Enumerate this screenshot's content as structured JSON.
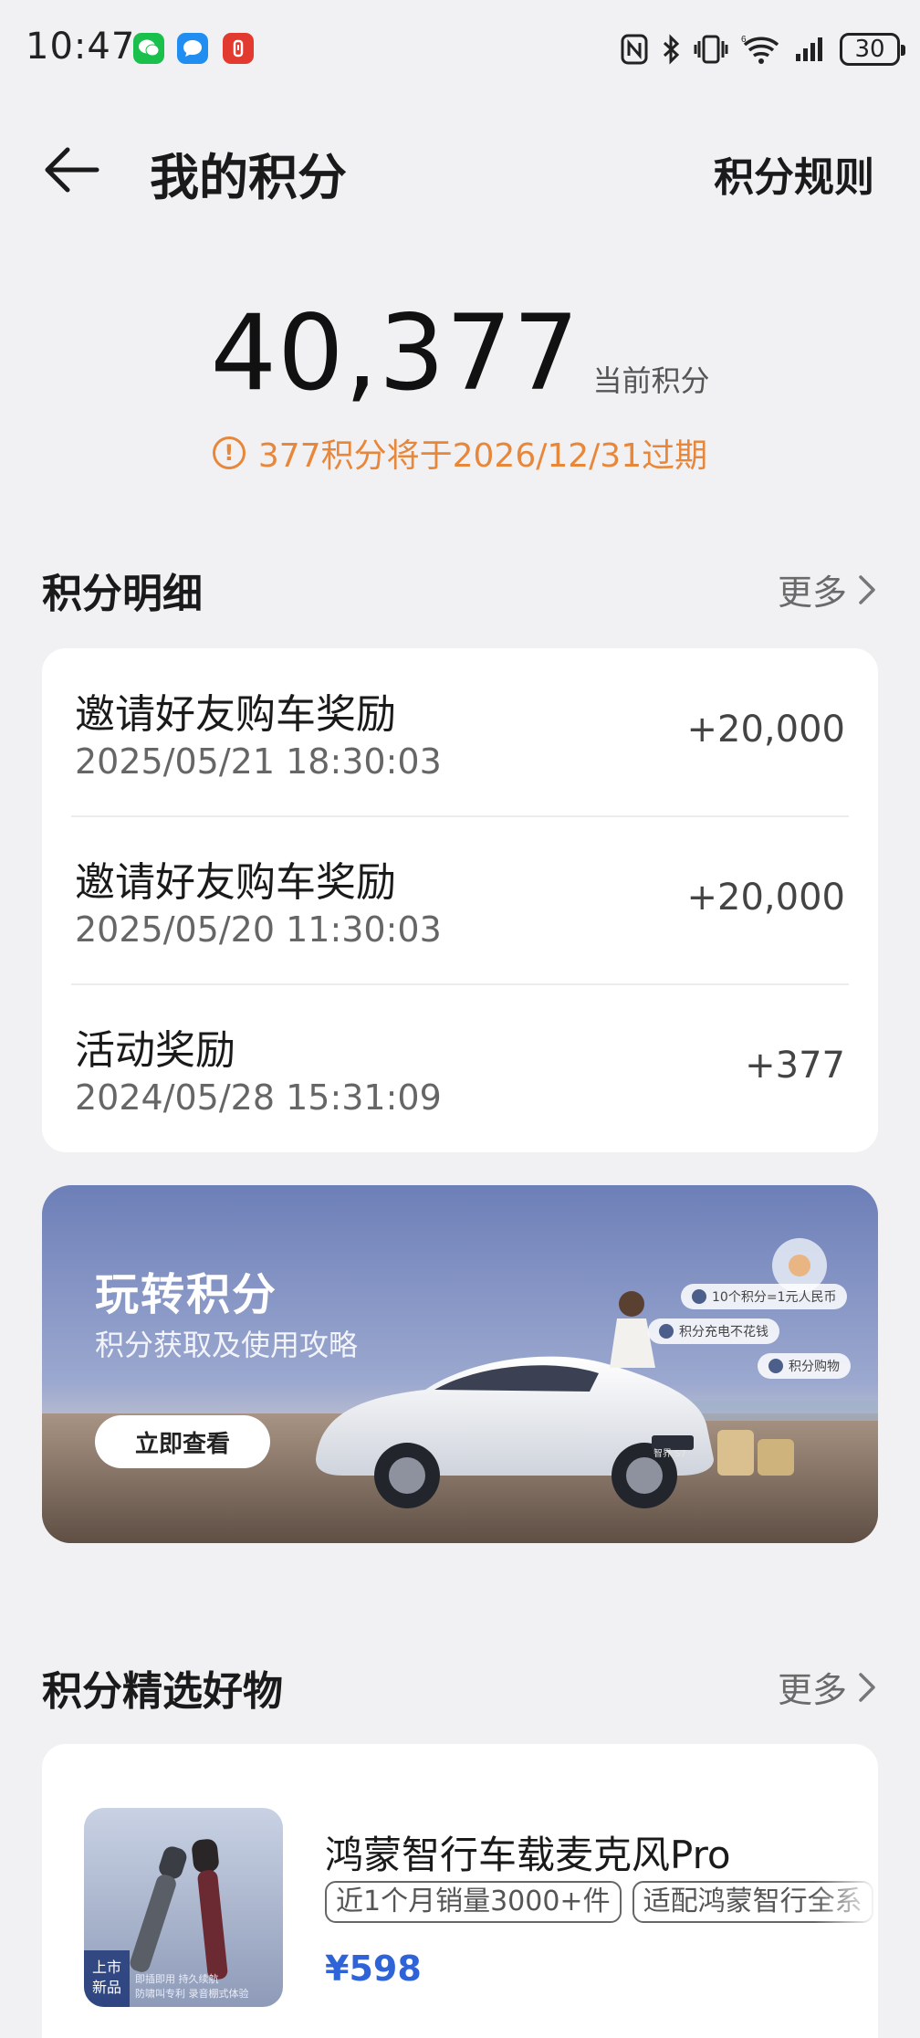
{
  "status_bar": {
    "time": "10:47",
    "battery": "30",
    "apps": [
      "wechat-icon",
      "messages-icon",
      "red-app-icon"
    ]
  },
  "header": {
    "title": "我的积分",
    "rules_label": "积分规则"
  },
  "points": {
    "value": "40,377",
    "label": "当前积分",
    "expiry_notice": "377积分将于2026/12/31过期"
  },
  "details": {
    "title": "积分明细",
    "more_label": "更多",
    "records": [
      {
        "title": "邀请好友购车奖励",
        "time": "2025/05/21 18:30:03",
        "amount": "+20,000"
      },
      {
        "title": "邀请好友购车奖励",
        "time": "2025/05/20 11:30:03",
        "amount": "+20,000"
      },
      {
        "title": "活动奖励",
        "time": "2024/05/28 15:31:09",
        "amount": "+377"
      }
    ]
  },
  "banner": {
    "title": "玩转积分",
    "subtitle": "积分获取及使用攻略",
    "button_label": "立即查看",
    "tags": [
      "10个积分=1元人民币",
      "积分充电不花钱",
      "积分购物"
    ],
    "plate": "智界 S7"
  },
  "products": {
    "title": "积分精选好物",
    "more_label": "更多",
    "items": [
      {
        "name": "鸿蒙智行车载麦克风Pro",
        "chips": [
          "近1个月销量3000+件",
          "适配鸿蒙智行全系"
        ],
        "price": "¥598",
        "badge_line1": "上市",
        "badge_line2": "新品",
        "caption_line1": "即插即用   持久续航",
        "caption_line2": "防啸叫专利   录音棚式体验"
      }
    ]
  },
  "colors": {
    "background": "#f1f1f3",
    "accent_orange": "#e8873a",
    "price_blue": "#2f63d8"
  }
}
